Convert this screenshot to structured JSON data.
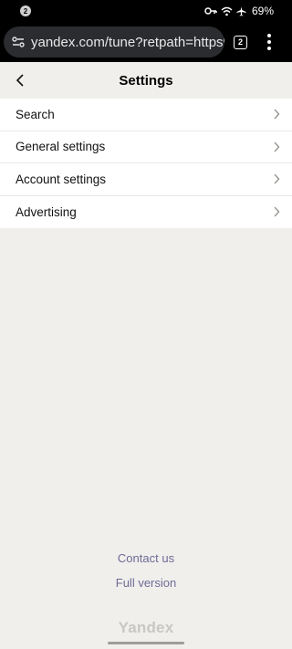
{
  "status_bar": {
    "notification_count": "2",
    "battery": "69%"
  },
  "browser": {
    "url": "yandex.com/tune?retpath=https%3",
    "tab_count": "2"
  },
  "header": {
    "title": "Settings"
  },
  "settings": {
    "items": [
      {
        "label": "Search"
      },
      {
        "label": "General settings"
      },
      {
        "label": "Account settings"
      },
      {
        "label": "Advertising"
      }
    ]
  },
  "footer": {
    "contact_label": "Contact us",
    "full_version_label": "Full version",
    "logo": "Yandex"
  },
  "colors": {
    "background": "#f0efec",
    "link": "#6e6b96"
  }
}
